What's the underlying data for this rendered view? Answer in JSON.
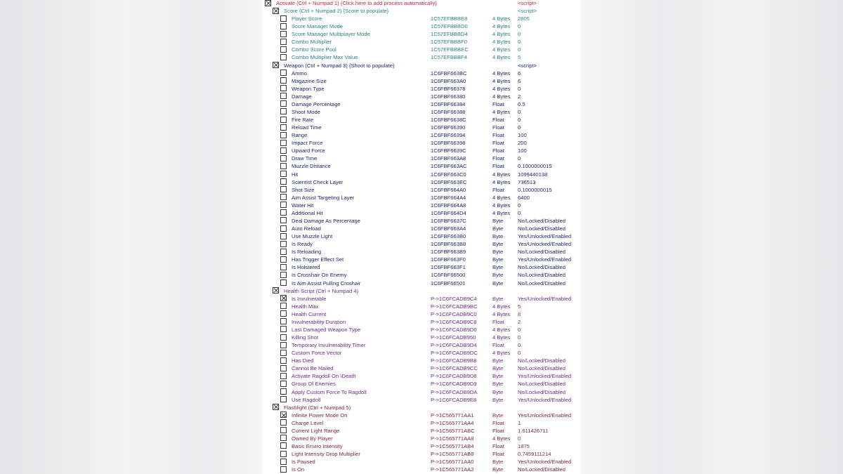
{
  "colors": {
    "activate": "#c8283a",
    "score": "#2a8585",
    "weapon": "#24246e",
    "health": "#6e2c86",
    "flashlight": "#7a2848"
  },
  "rows": [
    {
      "level": 0,
      "checked": true,
      "label": "Activate (Ctrl + Numpad 1) {Click here to add process automatically}",
      "value": "<script>",
      "color": "activate"
    },
    {
      "level": 1,
      "checked": true,
      "label": "Score (Ctrl + Numpad 2) {Score to populate}",
      "value": "<script>",
      "color": "score"
    },
    {
      "level": 2,
      "label": "Player Score",
      "address": "1C57EFBBBE8",
      "type": "4 Bytes",
      "value": "2805",
      "color": "score"
    },
    {
      "level": 2,
      "label": "Score Manager Mode",
      "address": "1C57EFBBBD0",
      "type": "4 Bytes",
      "value": "0",
      "color": "score"
    },
    {
      "level": 2,
      "label": "Score Manager Multiplayer Mode",
      "address": "1C57EFBBBD4",
      "type": "4 Bytes",
      "value": "0",
      "color": "score"
    },
    {
      "level": 2,
      "label": "Combo Multiplier",
      "address": "1C57EFBBBF0",
      "type": "4 Bytes",
      "value": "0",
      "color": "score"
    },
    {
      "level": 2,
      "label": "Combo Score Pool",
      "address": "1C57EFBBBEC",
      "type": "4 Bytes",
      "value": "0",
      "color": "score"
    },
    {
      "level": 2,
      "label": "Combo Multiplier Max Value",
      "address": "1C57EFBBBF4",
      "type": "4 Bytes",
      "value": "5",
      "color": "score"
    },
    {
      "level": 1,
      "checked": true,
      "label": "Weapon (Ctrl + Numpad 3) {Shoot to populate}",
      "value": "<script>",
      "color": "weapon"
    },
    {
      "level": 2,
      "label": "Ammo",
      "address": "1C6FBF663BC",
      "type": "4 Bytes",
      "value": "6",
      "color": "weapon"
    },
    {
      "level": 2,
      "label": "Magazine Size",
      "address": "1C6FBF663A0",
      "type": "4 Bytes",
      "value": "6",
      "color": "weapon"
    },
    {
      "level": 2,
      "label": "Weapon Type",
      "address": "1C6FBF66378",
      "type": "4 Bytes",
      "value": "0",
      "color": "weapon"
    },
    {
      "level": 2,
      "label": "Damage",
      "address": "1C6FBF66380",
      "type": "4 Bytes",
      "value": "2",
      "color": "weapon"
    },
    {
      "level": 2,
      "label": "Damage Percentage",
      "address": "1C6FBF66384",
      "type": "Float",
      "value": "0.5",
      "color": "weapon"
    },
    {
      "level": 2,
      "label": "Shoot Mode",
      "address": "1C6FBF66388",
      "type": "4 Bytes",
      "value": "0",
      "color": "weapon"
    },
    {
      "level": 2,
      "label": "Fire Rate",
      "address": "1C6FBF6638C",
      "type": "Float",
      "value": "0",
      "color": "weapon"
    },
    {
      "level": 2,
      "label": "Reload Time",
      "address": "1C6FBF66390",
      "type": "Float",
      "value": "0",
      "color": "weapon"
    },
    {
      "level": 2,
      "label": "Range",
      "address": "1C6FBF66394",
      "type": "Float",
      "value": "100",
      "color": "weapon"
    },
    {
      "level": 2,
      "label": "Impact Force",
      "address": "1C6FBF66398",
      "type": "Float",
      "value": "200",
      "color": "weapon"
    },
    {
      "level": 2,
      "label": "Upward Force",
      "address": "1C6FBF6639C",
      "type": "Float",
      "value": "100",
      "color": "weapon"
    },
    {
      "level": 2,
      "label": "Draw Time",
      "address": "1C6FBF663A8",
      "type": "Float",
      "value": "0",
      "color": "weapon"
    },
    {
      "level": 2,
      "label": "Muzzle Distance",
      "address": "1C6FBF663AC",
      "type": "Float",
      "value": "0.1000000015",
      "color": "weapon"
    },
    {
      "level": 2,
      "label": "Hit",
      "address": "1C6FBF663C0",
      "type": "4 Bytes",
      "value": "1099440138",
      "color": "weapon"
    },
    {
      "level": 2,
      "label": "Scientist Check Layer",
      "address": "1C6FBF663EC",
      "type": "4 Bytes",
      "value": "736513",
      "color": "weapon"
    },
    {
      "level": 2,
      "label": "Shot Size",
      "address": "1C6FBF664A0",
      "type": "Float",
      "value": "0.1000000015",
      "color": "weapon"
    },
    {
      "level": 2,
      "label": "Aim Assist Targeting Layer",
      "address": "1C6FBF664A4",
      "type": "4 Bytes",
      "value": "6400",
      "color": "weapon"
    },
    {
      "level": 2,
      "label": "Water Hit",
      "address": "1C6FBF664A8",
      "type": "4 Bytes",
      "value": "0",
      "color": "weapon"
    },
    {
      "level": 2,
      "label": "Additional Hit",
      "address": "1C6FBF664D4",
      "type": "4 Bytes",
      "value": "0",
      "color": "weapon"
    },
    {
      "level": 2,
      "label": "Deal Damage As Percentage",
      "address": "1C6FBF6637C",
      "type": "Byte",
      "value": "No/Locked/Disabled",
      "color": "weapon"
    },
    {
      "level": 2,
      "label": "Auto Reload",
      "address": "1C6FBF663A4",
      "type": "Byte",
      "value": "No/Locked/Disabled",
      "color": "weapon"
    },
    {
      "level": 2,
      "label": "Use Muzzle Light",
      "address": "1C6FBF663B0",
      "type": "Byte",
      "value": "Yes/Unlocked/Enabled",
      "color": "weapon"
    },
    {
      "level": 2,
      "label": "Is Ready",
      "address": "1C6FBF663B8",
      "type": "Byte",
      "value": "Yes/Unlocked/Enabled",
      "color": "weapon"
    },
    {
      "level": 2,
      "label": "Is Reloading",
      "address": "1C6FBF663B9",
      "type": "Byte",
      "value": "No/Locked/Disabled",
      "color": "weapon"
    },
    {
      "level": 2,
      "label": "Has Trigger Effect Set",
      "address": "1C6FBF663F0",
      "type": "Byte",
      "value": "Yes/Unlocked/Enabled",
      "color": "weapon"
    },
    {
      "level": 2,
      "label": "Is Holstered",
      "address": "1C6FBF663F1",
      "type": "Byte",
      "value": "No/Locked/Disabled",
      "color": "weapon"
    },
    {
      "level": 2,
      "label": "Is Crosshair On Enemy",
      "address": "1C6FBF66500",
      "type": "Byte",
      "value": "No/Locked/Disabled",
      "color": "weapon"
    },
    {
      "level": 2,
      "label": "Is Aim Assist Pulling Croshair",
      "address": "1C6FBF66501",
      "type": "Byte",
      "value": "No/Locked/Disabled",
      "color": "weapon"
    },
    {
      "level": 1,
      "checked": true,
      "label": "Health Script (Ctrl + Numpad 4)",
      "color": "health"
    },
    {
      "level": 2,
      "checked": true,
      "label": "Is Invulnerable",
      "address": "P->1C6FCADB9C4",
      "type": "Byte",
      "value": "Yes/Unlocked/Enabled",
      "color": "health"
    },
    {
      "level": 2,
      "label": "Health Max",
      "address": "P->1C6FCADB9BC",
      "type": "4 Bytes",
      "value": "5",
      "color": "health"
    },
    {
      "level": 2,
      "label": "Health Current",
      "address": "P->1C6FCADB9C0",
      "type": "4 Bytes",
      "value": "8",
      "color": "health"
    },
    {
      "level": 2,
      "label": "Invulnerability Duration",
      "address": "P->1C6FCADB9C8",
      "type": "Float",
      "value": "2",
      "color": "health"
    },
    {
      "level": 2,
      "label": "Last Damaged Weapon Type",
      "address": "P->1C6FCADB9D0",
      "type": "4 Bytes",
      "value": "0",
      "color": "health"
    },
    {
      "level": 2,
      "label": "Killing Shot",
      "address": "P->1C6FCADB950",
      "type": "4 Bytes",
      "value": "0",
      "color": "health"
    },
    {
      "level": 2,
      "label": "Temporary Invulnerability Timer",
      "address": "P->1C6FCADB9D4",
      "type": "Float",
      "value": "0",
      "color": "health"
    },
    {
      "level": 2,
      "label": "Custom Force Vector",
      "address": "P->1C6FCADB9DC",
      "type": "4 Bytes",
      "value": "0",
      "color": "health"
    },
    {
      "level": 2,
      "label": "Has Died",
      "address": "P->1C6FCADB9B8",
      "type": "Byte",
      "value": "No/Locked/Disabled",
      "color": "health"
    },
    {
      "level": 2,
      "label": "Cannot Be Nailed",
      "address": "P->1C6FCADB9CC",
      "type": "Byte",
      "value": "No/Locked/Disabled",
      "color": "health"
    },
    {
      "level": 2,
      "label": "Activate Ragdoll On \\Death",
      "address": "P->1C6FCADB9D8",
      "type": "Byte",
      "value": "Yes/Unlocked/Enabled",
      "color": "health"
    },
    {
      "level": 2,
      "label": "Group Of Enemies",
      "address": "P->1C6FCADB9D9",
      "type": "Byte",
      "value": "No/Locked/Disabled",
      "color": "health"
    },
    {
      "level": 2,
      "label": "Apply Custom Force To Ragdoll",
      "address": "P->1C6FCADB9DA",
      "type": "Byte",
      "value": "No/Locked/Disabled",
      "color": "health"
    },
    {
      "level": 2,
      "label": "Use Ragdoll",
      "address": "P->1C6FCADB9E8",
      "type": "Byte",
      "value": "Yes/Unlocked/Enabled",
      "color": "health"
    },
    {
      "level": 1,
      "checked": true,
      "label": "Flashlight (Ctrl + Numpad 5)",
      "color": "flashlight"
    },
    {
      "level": 2,
      "checked": true,
      "label": "Infinite Power Mode On",
      "address": "P->1C565771AA1",
      "type": "Byte",
      "value": "Yes/Unlocked/Enabled",
      "color": "flashlight"
    },
    {
      "level": 2,
      "label": "Charge Level",
      "address": "P->1C565771AA4",
      "type": "Float",
      "value": "1",
      "color": "flashlight"
    },
    {
      "level": 2,
      "label": "Current Light Range",
      "address": "P->1C565771ABC",
      "type": "Float",
      "value": "1.611426711",
      "color": "flashlight"
    },
    {
      "level": 2,
      "label": "Owned By Player",
      "address": "P->1C565771AA8",
      "type": "4 Bytes",
      "value": "0",
      "color": "flashlight"
    },
    {
      "level": 2,
      "label": "Basic Enviro Intensity",
      "address": "P->1C565771AB4",
      "type": "Float",
      "value": "1875",
      "color": "flashlight"
    },
    {
      "level": 2,
      "label": "Light Intensity Drop Multiplier",
      "address": "P->1C565771AB8",
      "type": "Float",
      "value": "0.7459111214",
      "color": "flashlight"
    },
    {
      "level": 2,
      "label": "Is Paused",
      "address": "P->1C565771AA0",
      "type": "Byte",
      "value": "Yes/Unlocked/Enabled",
      "color": "flashlight"
    },
    {
      "level": 2,
      "label": "Is On",
      "address": "P->1C565771AA2",
      "type": "Byte",
      "value": "No/Locked/Disabled",
      "color": "flashlight"
    }
  ]
}
